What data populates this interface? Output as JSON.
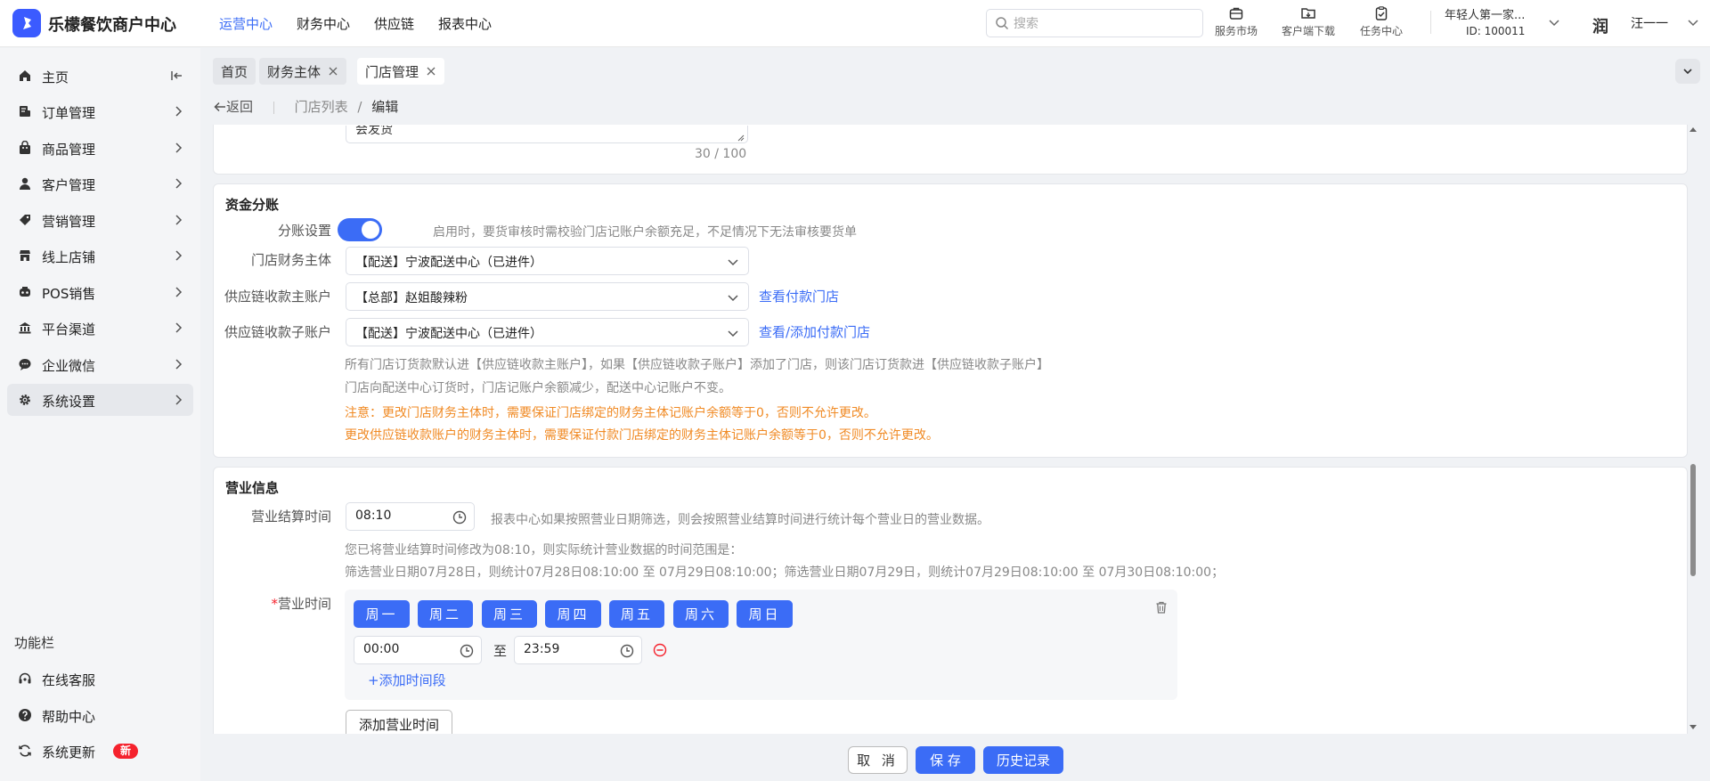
{
  "app": {
    "title": "乐檬餐饮商户中心",
    "accent": "#3b6cf6"
  },
  "topnav": [
    "运营中心",
    "财务中心",
    "供应链",
    "报表中心"
  ],
  "search": {
    "placeholder": "搜索",
    "value": ""
  },
  "tools": [
    {
      "label": "服务市场",
      "icon": "briefcase-icon"
    },
    {
      "label": "客户端下载",
      "icon": "download-folder-icon"
    },
    {
      "label": "任务中心",
      "icon": "clipboard-check-icon"
    }
  ],
  "account": {
    "name": "年轻人第一家...",
    "id": "ID: 100011"
  },
  "user": {
    "logo": "润",
    "name": "汪一一"
  },
  "sidebar": {
    "items": [
      {
        "label": "主页",
        "icon": "home-icon"
      },
      {
        "label": "订单管理",
        "icon": "order-icon"
      },
      {
        "label": "商品管理",
        "icon": "bag-icon"
      },
      {
        "label": "客户管理",
        "icon": "user-icon"
      },
      {
        "label": "营销管理",
        "icon": "tag-icon"
      },
      {
        "label": "线上店铺",
        "icon": "store-icon"
      },
      {
        "label": "POS销售",
        "icon": "pos-icon"
      },
      {
        "label": "平台渠道",
        "icon": "bank-icon"
      },
      {
        "label": "企业微信",
        "icon": "chat-icon"
      },
      {
        "label": "系统设置",
        "icon": "gear-icon"
      }
    ],
    "section_title": "功能栏",
    "bottom": [
      {
        "label": "在线客服",
        "icon": "headset-icon"
      },
      {
        "label": "帮助中心",
        "icon": "help-icon"
      },
      {
        "label": "系统更新",
        "icon": "refresh-icon",
        "badge": "新"
      }
    ]
  },
  "tabs": [
    {
      "label": "首页",
      "closable": false
    },
    {
      "label": "财务主体",
      "closable": true
    },
    {
      "label": "门店管理",
      "closable": true
    }
  ],
  "breadcrumb": {
    "back": "返回",
    "parent": "门店列表",
    "separator": "/",
    "current": "编辑"
  },
  "top_card": {
    "textarea_tail": "会发货",
    "counter": "30 / 100"
  },
  "funds": {
    "title": "资金分账",
    "split_label": "分账设置",
    "split_on": true,
    "split_hint": "启用时，要货审核时需校验门店记账户余额充足，不足情况下无法审核要货单",
    "entity_label": "门店财务主体",
    "entity_value": "【配送】宁波配送中心（已进件）",
    "main_account_label": "供应链收款主账户",
    "main_account_value": "【总部】赵姐酸辣粉",
    "main_account_link": "查看付款门店",
    "sub_account_label": "供应链收款子账户",
    "sub_account_value": "【配送】宁波配送中心（已进件）",
    "sub_account_link": "查看/添加付款门店",
    "note1": "所有门店订货款默认进【供应链收款主账户】，如果【供应链收款子账户】添加了门店，则该门店订货款进【供应链收款子账户】",
    "note2": "门店向配送中心订货时，门店记账户余额减少，配送中心记账户不变。",
    "warn1": "注意：更改门店财务主体时，需要保证门店绑定的财务主体记账户余额等于0，否则不允许更改。",
    "warn2": "更改供应链收款账户的财务主体时，需要保证付款门店绑定的财务主体记账户余额等于0，否则不允许更改。"
  },
  "business": {
    "title": "营业信息",
    "settle_label": "营业结算时间",
    "settle_value": "08:10",
    "settle_hint": "报表中心如果按照营业日期筛选，则会按照营业结算时间进行统计每个营业日的营业数据。",
    "settle_note1": "您已将营业结算时间修改为08:10，则实际统计营业数据的时间范围是：",
    "settle_note2": "筛选营业日期07月28日，则统计07月28日08:10:00 至 07月29日08:10:00；筛选营业日期07月29日，则统计07月29日08:10:00 至 07月30日08:10:00；",
    "hours_label": "营业时间",
    "required_mark": "*",
    "days": [
      "周一",
      "周二",
      "周三",
      "周四",
      "周五",
      "周六",
      "周日"
    ],
    "start": "00:00",
    "to": "至",
    "end": "23:59",
    "add_segment": "+添加时间段",
    "add_hours": "添加营业时间"
  },
  "footer": {
    "cancel": "取 消",
    "save": "保 存",
    "history": "历史记录"
  }
}
